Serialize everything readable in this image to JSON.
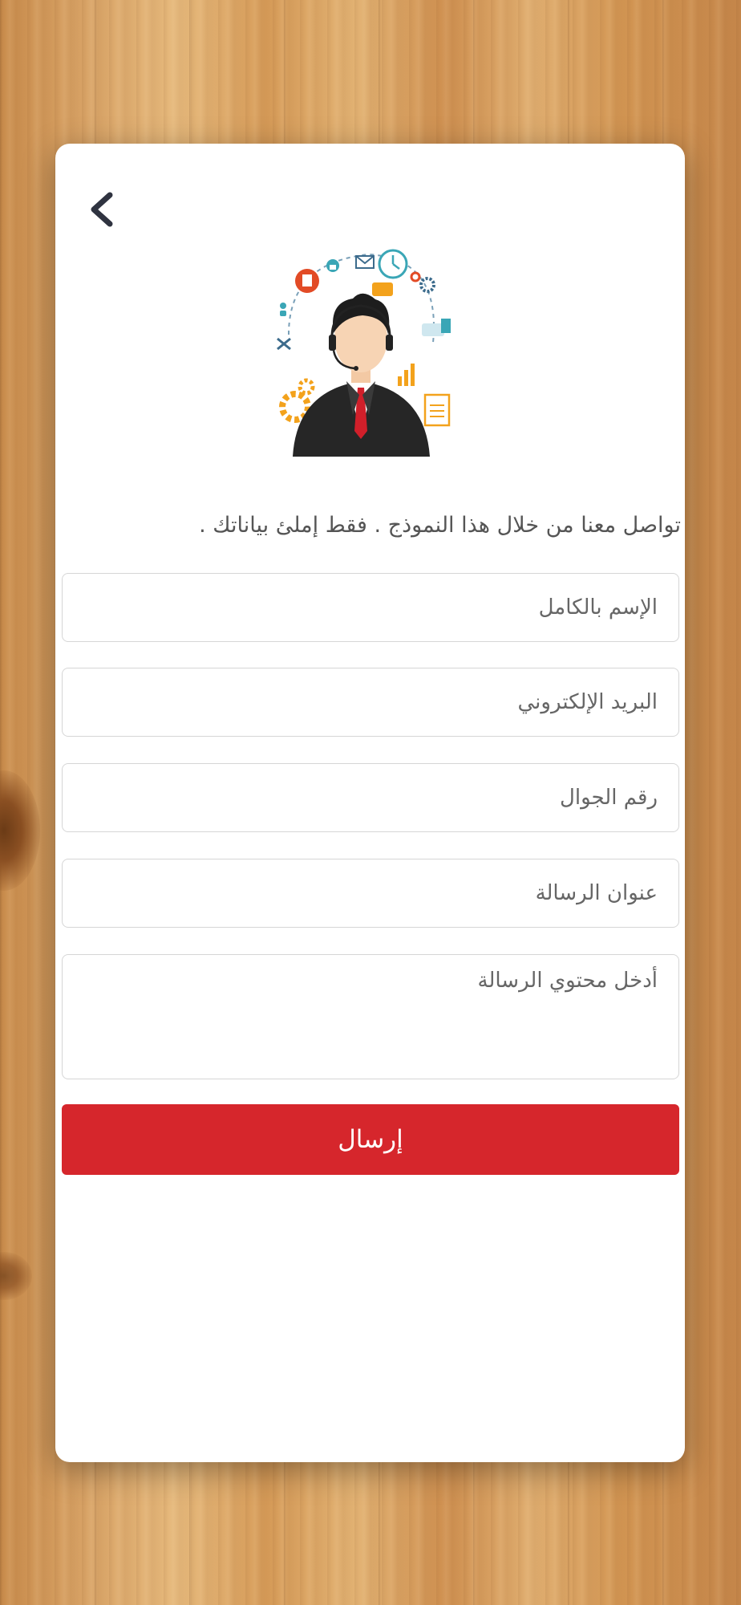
{
  "header": {
    "back_icon": "chevron-left-icon"
  },
  "illustration": {
    "icon": "customer-support-agent-icon"
  },
  "intro_text": "تواصل معنا من خلال هذا النموذج . فقط إملئ بياناتك .",
  "form": {
    "full_name_placeholder": "الإسم بالكامل",
    "email_placeholder": "البريد الإلكتروني",
    "phone_placeholder": "رقم الجوال",
    "subject_placeholder": "عنوان الرسالة",
    "message_placeholder": "أدخل محتوي الرسالة",
    "submit_label": "إرسال"
  },
  "colors": {
    "accent": "#d6262c",
    "background": "#d9a467",
    "card": "#ffffff",
    "text": "#555555"
  }
}
